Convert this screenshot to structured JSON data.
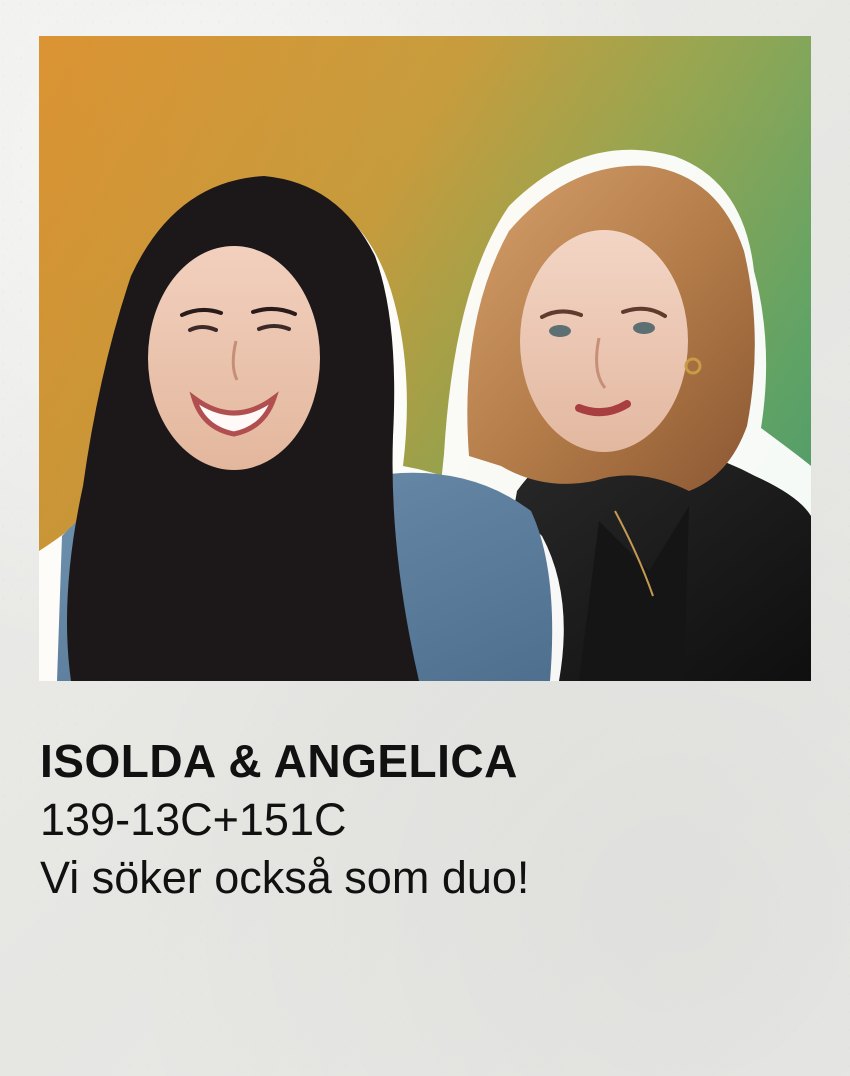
{
  "card": {
    "name": "ISOLDA & ANGELICA",
    "code": "139-13C+151C",
    "note": "Vi söker också som duo!"
  },
  "photo": {
    "subjects": [
      {
        "id": "left-person",
        "hair": "dark brown",
        "clothing": "denim shirt"
      },
      {
        "id": "right-person",
        "hair": "strawberry blonde curls",
        "clothing": "black leather jacket"
      }
    ],
    "background_gradient": [
      "#d88a22",
      "#4ca57a"
    ]
  }
}
